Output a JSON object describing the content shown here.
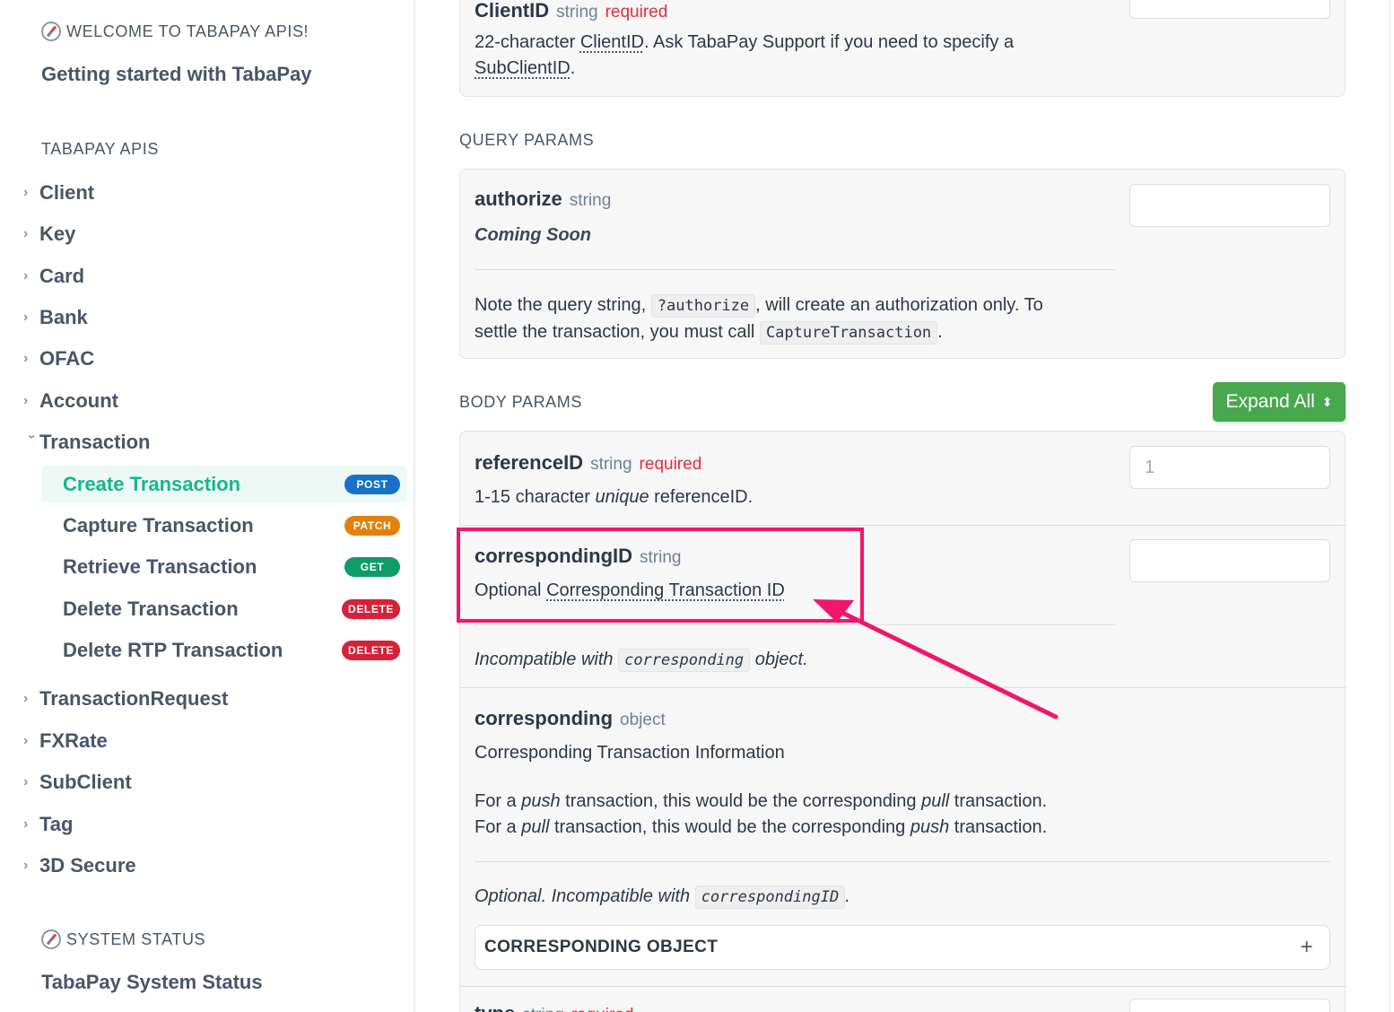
{
  "sidebar": {
    "welcome_heading": "WELCOME TO TABAPAY APIS!",
    "getting_started": "Getting started with TabaPay",
    "apis_heading": "TABAPAY APIS",
    "top_items": [
      "Client",
      "Key",
      "Card",
      "Bank",
      "OFAC",
      "Account"
    ],
    "transaction": {
      "label": "Transaction",
      "children": [
        {
          "label": "Create Transaction",
          "method": "POST",
          "active": true
        },
        {
          "label": "Capture Transaction",
          "method": "PATCH"
        },
        {
          "label": "Retrieve Transaction",
          "method": "GET"
        },
        {
          "label": "Delete Transaction",
          "method": "DELETE"
        },
        {
          "label": "Delete RTP Transaction",
          "method": "DELETE"
        }
      ]
    },
    "bottom_items": [
      "TransactionRequest",
      "FXRate",
      "SubClient",
      "Tag",
      "3D Secure"
    ],
    "status_heading": "SYSTEM STATUS",
    "status_link": "TabaPay System Status"
  },
  "main": {
    "client_param": {
      "name": "ClientID",
      "type": "string",
      "required": "required",
      "desc_1": "22-character ",
      "desc_link_1": "ClientID",
      "desc_2": ". Ask TabaPay Support if you need to specify a",
      "desc_link_2": "SubClientID",
      "desc_3": "."
    },
    "query_title": "QUERY PARAMS",
    "authorize": {
      "name": "authorize",
      "type": "string",
      "italic_desc": "Coming Soon",
      "note_1": "Note the query string, ",
      "note_code_1": "?authorize",
      "note_2": ", will create an authorization only. To",
      "note_3": "settle the transaction, you must call ",
      "note_code_2": "CaptureTransaction",
      "note_4": "."
    },
    "body_title": "BODY PARAMS",
    "expand_all": "Expand All",
    "expand_icon": "⬍",
    "reference": {
      "name": "referenceID",
      "type": "string",
      "required": "required",
      "desc_1": "1-15 character ",
      "desc_italic": "unique",
      "desc_2": " referenceID.",
      "placeholder": "1"
    },
    "corresponding_id": {
      "name": "correspondingID",
      "type": "string",
      "desc_1": "Optional ",
      "desc_link": "Corresponding Transaction ID",
      "note_1": "Incompatible with ",
      "note_code": "corresponding",
      "note_2": " object."
    },
    "corresponding": {
      "name": "corresponding",
      "type": "object",
      "desc": "Corresponding Transaction Information",
      "line1_a": "For a ",
      "line1_b": "push",
      "line1_c": " transaction, this would be the corresponding ",
      "line1_d": "pull",
      "line1_e": " transaction.",
      "line2_a": "For a ",
      "line2_b": "pull",
      "line2_c": " transaction, this would be the corresponding ",
      "line2_d": "push",
      "line2_e": " transaction.",
      "note_1": "Optional. Incompatible with ",
      "note_code": "correspondingID",
      "note_2": ".",
      "object_bar": "CORRESPONDING OBJECT",
      "plus": "+"
    },
    "type_param": {
      "name": "type",
      "type": "string",
      "required": "required"
    }
  },
  "annotation_color": "#f0166c"
}
